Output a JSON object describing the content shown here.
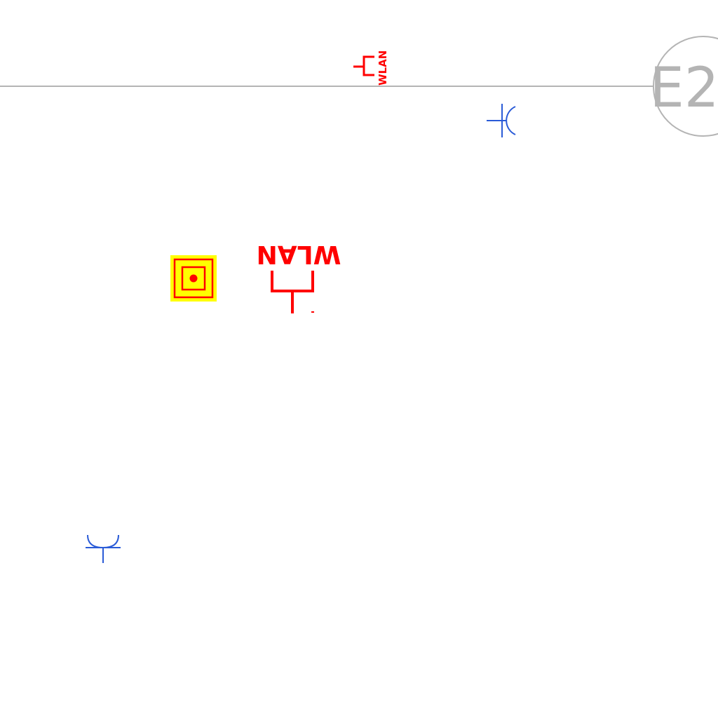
{
  "drawing": {
    "grid_bubble": {
      "label": "E2",
      "color": "#b4b4b4"
    },
    "wlan_symbols": [
      {
        "label": "WLAN"
      },
      {
        "label": "WLAN"
      }
    ],
    "colors": {
      "wlan_red": "#ff0000",
      "highlight_yellow": "#ffff00",
      "phone_outlet_blue": "#2a5bd7",
      "grid_line": "#b4b4b4"
    },
    "icons": {
      "highlighted_device": "square-target-icon",
      "data_outlet": "wlan-antenna-icon",
      "phone_outlet": "telephone-outlet-icon"
    }
  }
}
